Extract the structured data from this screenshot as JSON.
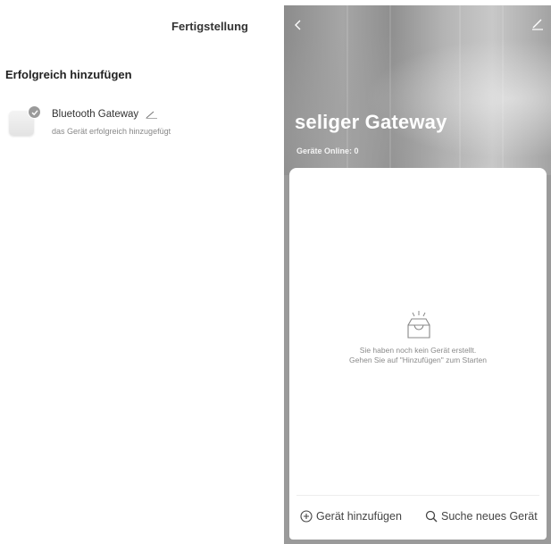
{
  "left_screen": {
    "header_title": "Fertigstellung",
    "section_title": "Erfolgreich hinzufügen",
    "device": {
      "name": "Bluetooth Gateway",
      "status": "das Gerät erfolgreich hinzugefügt",
      "badge_icon": "check-icon",
      "edit_icon": "pencil-icon"
    }
  },
  "right_screen": {
    "back_icon": "chevron-left-icon",
    "edit_icon": "pencil-icon",
    "title": "seliger Gateway",
    "online_label": "Geräte Online: 0",
    "empty_state": {
      "icon": "empty-tray-icon",
      "line1": "Sie haben noch kein Gerät erstellt.",
      "line2": "Gehen Sie auf \"Hinzufügen\" zum Starten"
    },
    "actions": {
      "add_label": "Gerät hinzufügen",
      "add_icon": "plus-circle-icon",
      "search_label": "Suche neues Gerät",
      "search_icon": "search-icon"
    }
  },
  "colors": {
    "background": "#ffffff",
    "hero_gray": "#9a9a9a",
    "text_dark": "#333333",
    "text_muted": "#888888"
  }
}
